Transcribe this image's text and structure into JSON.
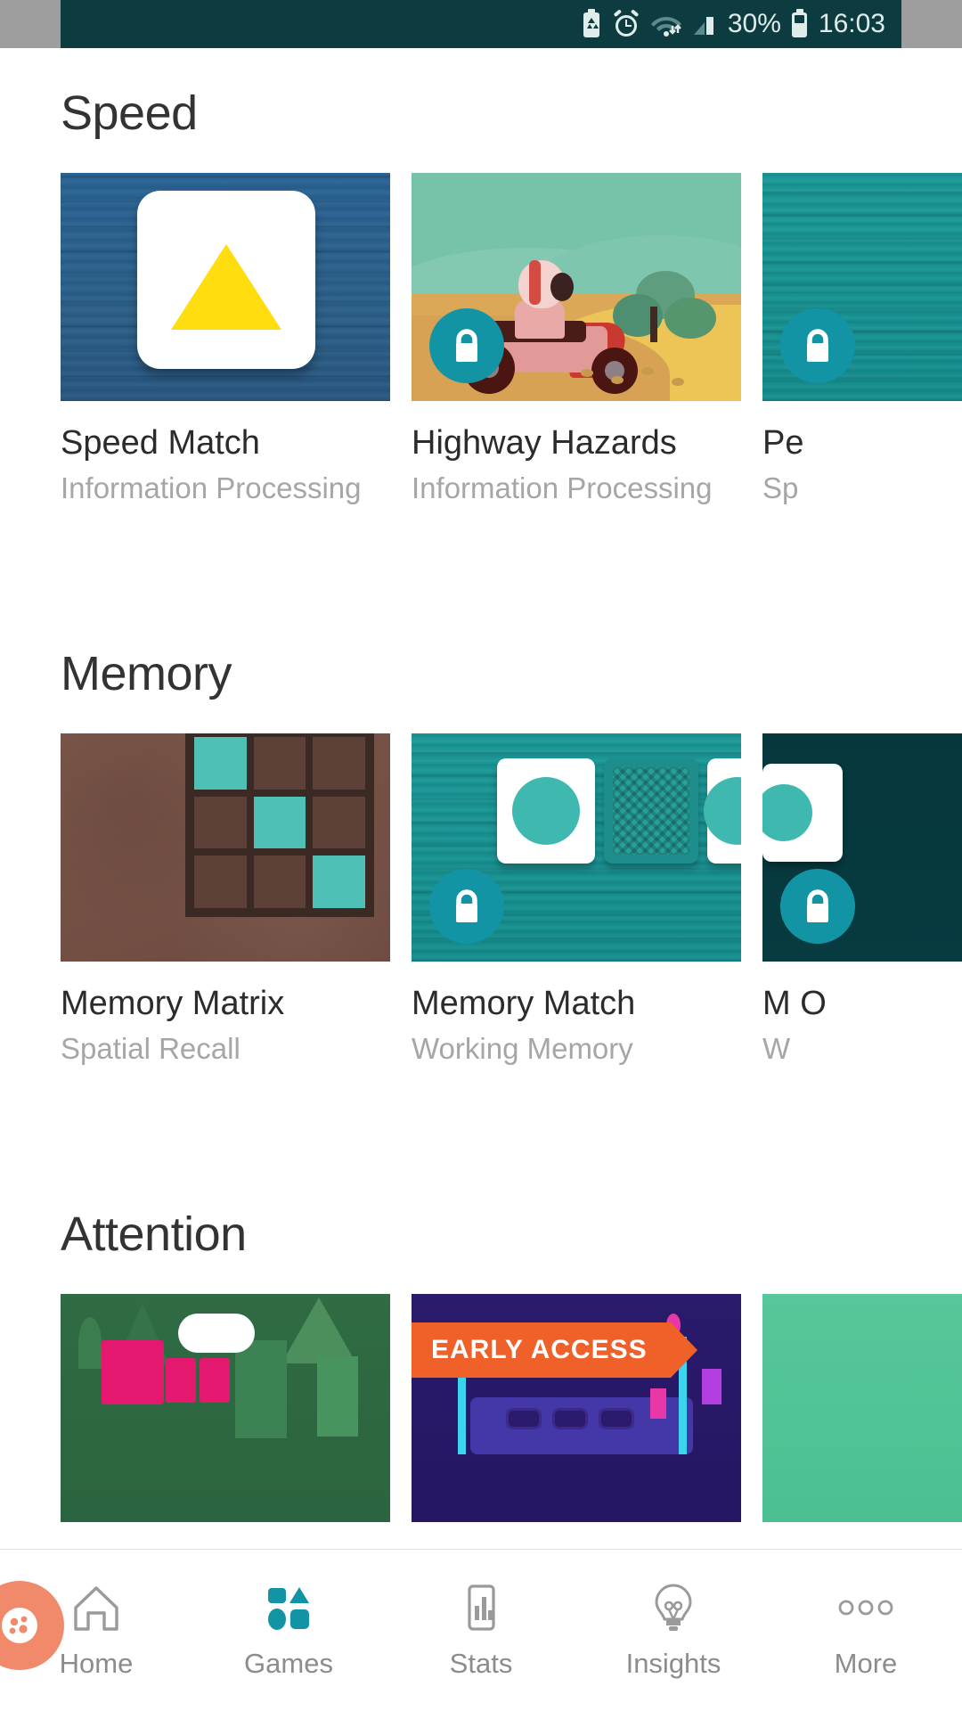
{
  "status_bar": {
    "battery_percent": "30%",
    "time": "16:03",
    "icons": [
      "battery-saver-icon",
      "alarm-icon",
      "wifi-icon",
      "signal-icon",
      "battery-icon"
    ],
    "background_color": "#0d3c40",
    "text_color": "#dfeceb"
  },
  "sections": [
    {
      "title": "Speed",
      "games": [
        {
          "title": "Speed Match",
          "subtitle": "Information Processing",
          "locked": false,
          "art": "speed-match"
        },
        {
          "title": "Highway Hazards",
          "subtitle": "Information Processing",
          "locked": true,
          "art": "highway-hazards"
        },
        {
          "title": "Pe",
          "subtitle": "Sp",
          "locked": true,
          "art": "teal-wood-partial"
        }
      ]
    },
    {
      "title": "Memory",
      "games": [
        {
          "title": "Memory Matrix",
          "subtitle": "Spatial Recall",
          "locked": false,
          "art": "memory-matrix"
        },
        {
          "title": "Memory Match",
          "subtitle": "Working Memory",
          "locked": true,
          "art": "memory-match"
        },
        {
          "title": "M\nO",
          "subtitle": "W",
          "locked": true,
          "art": "dark-teal-partial"
        }
      ]
    },
    {
      "title": "Attention",
      "games": [
        {
          "title": "",
          "subtitle": "",
          "locked": false,
          "art": "train-green"
        },
        {
          "title": "",
          "subtitle": "",
          "locked": false,
          "art": "neon-purple",
          "badge": "EARLY ACCESS"
        },
        {
          "title": "",
          "subtitle": "",
          "locked": false,
          "art": "mint-partial"
        }
      ]
    }
  ],
  "badges": {
    "early_access": "EARLY ACCESS"
  },
  "bottom_nav": {
    "items": [
      {
        "label": "Home",
        "icon": "home-icon",
        "active": false
      },
      {
        "label": "Games",
        "icon": "shapes-icon",
        "active": true
      },
      {
        "label": "Stats",
        "icon": "bar-chart-icon",
        "active": false
      },
      {
        "label": "Insights",
        "icon": "lightbulb-icon",
        "active": false
      },
      {
        "label": "More",
        "icon": "ellipsis-icon",
        "active": false
      }
    ],
    "active_color": "#1394a5",
    "inactive_color": "#8c8c8c"
  },
  "fab": {
    "icon": "assistant-bubble-icon",
    "color": "#f08a6a"
  },
  "theme": {
    "accent": "#1394a5",
    "lock_badge": "#1394a5",
    "ribbon": "#ef6128",
    "heading": "#333333",
    "subtitle": "#a6a6a6"
  }
}
